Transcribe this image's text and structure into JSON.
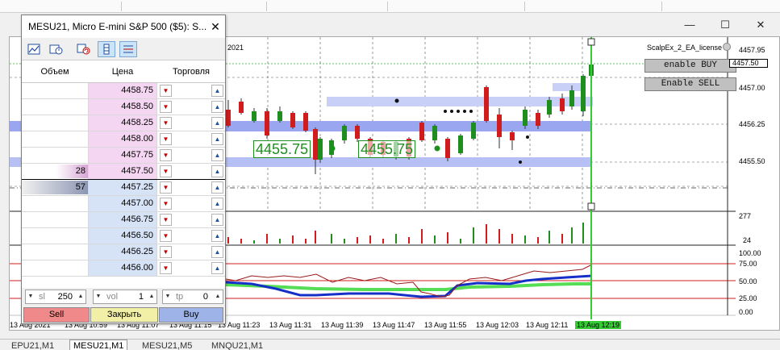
{
  "window": {
    "minimize": "—",
    "maximize": "☐",
    "close": "✕"
  },
  "dom": {
    "title": "MESU21, Micro E-mini S&P 500 ($5): S...",
    "close": "✕",
    "toolbar": [
      {
        "icon": "chart-icon"
      },
      {
        "icon": "settings-clock-icon"
      },
      {
        "icon": "refresh-icon"
      },
      {
        "icon": "bars-icon"
      },
      {
        "icon": "list-icon"
      }
    ],
    "columns": {
      "volume": "Объем",
      "price": "Цена",
      "trade": "Торговля"
    },
    "rows": [
      {
        "price": "4458.75",
        "volume": "",
        "side": "ask",
        "vol_fraction": 0
      },
      {
        "price": "4458.50",
        "volume": "",
        "side": "ask",
        "vol_fraction": 0
      },
      {
        "price": "4458.25",
        "volume": "",
        "side": "ask",
        "vol_fraction": 0
      },
      {
        "price": "4458.00",
        "volume": "",
        "side": "ask",
        "vol_fraction": 0
      },
      {
        "price": "4457.75",
        "volume": "",
        "side": "ask",
        "vol_fraction": 0
      },
      {
        "price": "4457.50",
        "volume": "28",
        "side": "ask",
        "vol_fraction": 0.49
      },
      {
        "price": "4457.25",
        "volume": "57",
        "side": "bid",
        "vol_fraction": 1.0
      },
      {
        "price": "4457.00",
        "volume": "",
        "side": "bid",
        "vol_fraction": 0
      },
      {
        "price": "4456.75",
        "volume": "",
        "side": "bid",
        "vol_fraction": 0
      },
      {
        "price": "4456.50",
        "volume": "",
        "side": "bid",
        "vol_fraction": 0
      },
      {
        "price": "4456.25",
        "volume": "",
        "side": "bid",
        "vol_fraction": 0
      },
      {
        "price": "4456.00",
        "volume": "",
        "side": "bid",
        "vol_fraction": 0
      }
    ],
    "arrow_down": "▼",
    "arrow_up": "▲",
    "sl": {
      "label": "sl",
      "value": "250"
    },
    "vol": {
      "label": "vol",
      "value": "1"
    },
    "tp": {
      "label": "tp",
      "value": "0"
    },
    "spin_down": "▼",
    "spin_up": "▲",
    "sell_label": "Sell",
    "close_label": "Закрыть",
    "buy_label": "Buy",
    "colors": {
      "ask": "#f4d6f2",
      "bid": "#d6e2f6",
      "sell": "#f08a8a",
      "close": "#f2f0a6",
      "buy": "#9eb4e8"
    }
  },
  "chart": {
    "year_label": "2021",
    "ea_label": "ScalpEx_2_EA_license",
    "enable_buy": "enable BUY",
    "enable_sell": "Enable SELL",
    "level_label_1": "4455.75",
    "level_label_2": "4455.75",
    "price_scale": [
      "4457.95",
      "4457.50",
      "4457.00",
      "4456.25",
      "4455.50"
    ],
    "current_price": "4457.50",
    "volume_scale": [
      "277",
      "24"
    ],
    "osc_scale": [
      "100.00",
      "75.00",
      "50.00",
      "25.00",
      "0.00"
    ],
    "time_axis": [
      "13 Aug 2021",
      "13 Aug 10:59",
      "13 Aug 11:07",
      "13 Aug 11:15",
      "13 Aug 11:23",
      "13 Aug 11:31",
      "13 Aug 11:39",
      "13 Aug 11:47",
      "13 Aug 11:55",
      "13 Aug 12:03",
      "13 Aug 12:11",
      "13 Aug 12:19"
    ],
    "current_time": "13 Aug 12:19",
    "colors": {
      "bull": "#1e8f1e",
      "bear": "#d01c1c",
      "zone": "#9aa6f0",
      "zone_light": "#c8d0f8",
      "cursor": "#33cc33"
    }
  },
  "tabs": [
    "EPU21,M1",
    "MESU21,M1",
    "MESU21,M5",
    "MNQU21,M1"
  ],
  "active_tab": 1
}
